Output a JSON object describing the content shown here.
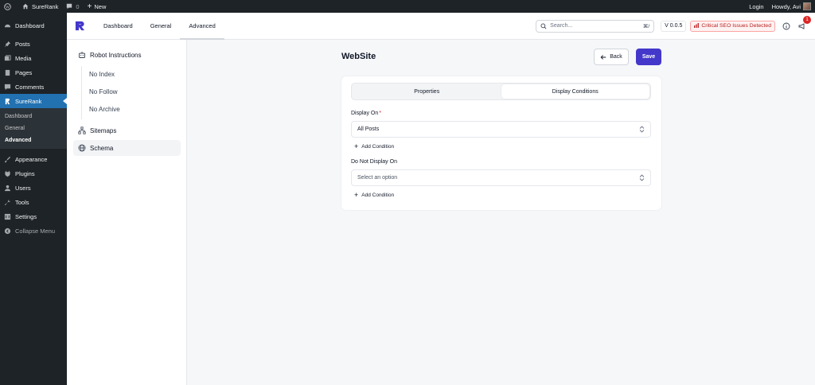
{
  "admin_bar": {
    "site_name": "SureRank",
    "comments_count": "0",
    "new_label": "New",
    "login_label": "Login",
    "howdy": "Howdy, Avi"
  },
  "wp_menu": {
    "dashboard": "Dashboard",
    "posts": "Posts",
    "media": "Media",
    "pages": "Pages",
    "comments": "Comments",
    "surerank": "SureRank",
    "sub": {
      "dashboard": "Dashboard",
      "general": "General",
      "advanced": "Advanced"
    },
    "appearance": "Appearance",
    "plugins": "Plugins",
    "users": "Users",
    "tools": "Tools",
    "settings": "Settings",
    "collapse": "Collapse Menu"
  },
  "top_nav": {
    "tabs": [
      "Dashboard",
      "General",
      "Advanced"
    ],
    "active_tab": "Advanced",
    "search_placeholder": "Search...",
    "search_shortcut": "⌘/",
    "version": "V 0.0.5",
    "critical_label": "Critical SEO Issues Detected",
    "notification_count": "1"
  },
  "sr_sidebar": {
    "robot": "Robot Instructions",
    "no_index": "No Index",
    "no_follow": "No Follow",
    "no_archive": "No Archive",
    "sitemaps": "Sitemaps",
    "schema": "Schema"
  },
  "main": {
    "title": "WebSite",
    "back_label": "Back",
    "save_label": "Save",
    "tabs": [
      "Properties",
      "Display Conditions"
    ],
    "selected_tab": "Display Conditions",
    "display_on_label": "Display On",
    "required_mark": "*",
    "display_on_value": "All Posts",
    "add_condition": "Add Condition",
    "not_display_label": "Do Not Display On",
    "not_display_placeholder": "Select an option"
  },
  "colors": {
    "wp_dark": "#1d2327",
    "wp_active": "#2271b1",
    "primary": "#4338ca",
    "danger": "#dc2626"
  }
}
